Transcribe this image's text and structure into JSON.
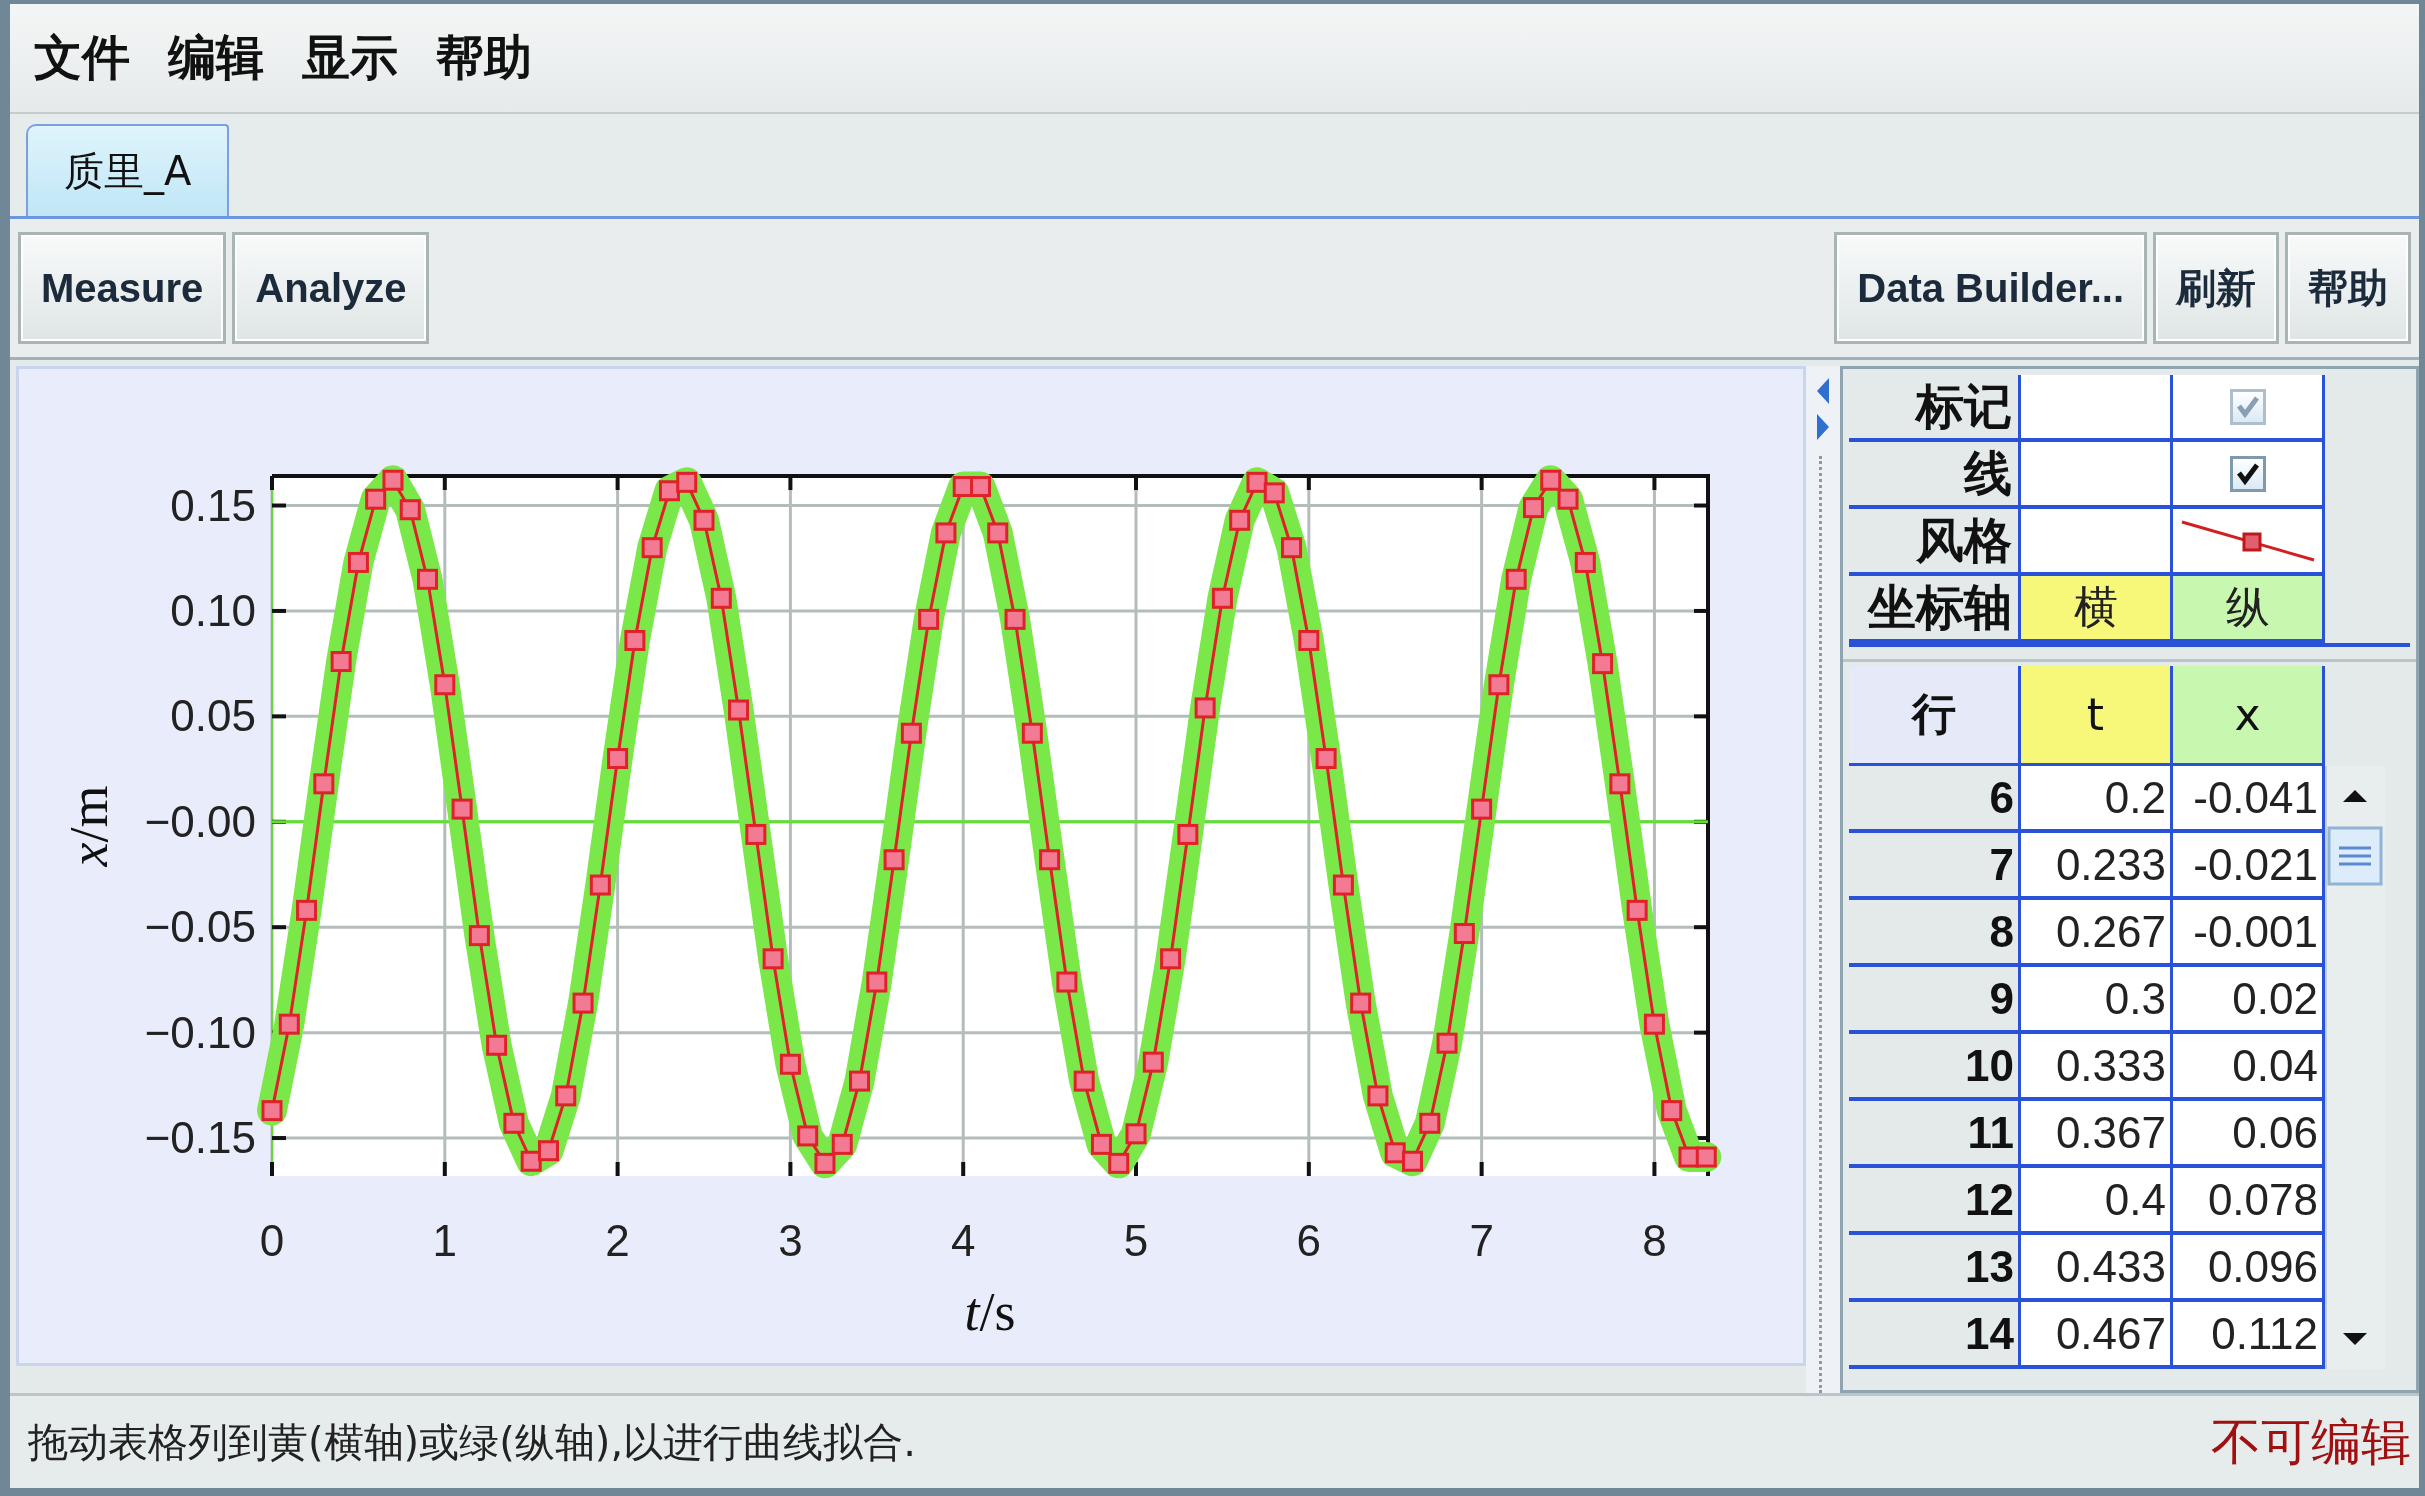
{
  "menu": [
    "文件",
    "编辑",
    "显示",
    "帮助"
  ],
  "tabs": [
    {
      "label": "质里_A",
      "selected": true
    }
  ],
  "toolbar": {
    "left": [
      "Measure",
      "Analyze"
    ],
    "right": [
      "Data Builder...",
      "刷新",
      "帮助"
    ]
  },
  "plot": {
    "chart_data": {
      "type": "line",
      "xlabel": "*t*/s",
      "ylabel": "*x*/m",
      "x": [
        0,
        0.1,
        0.2,
        0.3,
        0.4,
        0.5,
        0.6,
        0.7,
        0.8,
        0.9,
        1.0,
        1.1,
        1.2,
        1.3,
        1.4,
        1.5,
        1.6,
        1.7,
        1.8,
        1.9,
        2.0,
        2.1,
        2.2,
        2.3,
        2.4,
        2.5,
        2.6,
        2.7,
        2.8,
        2.9,
        3.0,
        3.1,
        3.2,
        3.3,
        3.4,
        3.5,
        3.6,
        3.7,
        3.8,
        3.9,
        4.0,
        4.1,
        4.2,
        4.3,
        4.4,
        4.5,
        4.6,
        4.7,
        4.8,
        4.9,
        5.0,
        5.1,
        5.2,
        5.3,
        5.4,
        5.5,
        5.6,
        5.7,
        5.8,
        5.9,
        6.0,
        6.1,
        6.2,
        6.3,
        6.4,
        6.5,
        6.6,
        6.7,
        6.8,
        6.9,
        7.0,
        7.1,
        7.2,
        7.3,
        7.4,
        7.5,
        7.6,
        7.7,
        7.8,
        7.9,
        8.0,
        8.1,
        8.2,
        8.3
      ],
      "grid": true,
      "ref_lines": [
        {
          "axis": "y",
          "value": 0,
          "color": "#5fe030"
        }
      ],
      "series": [
        {
          "color": "#e0202a",
          "marker": "square",
          "values": [
            -0.137,
            -0.096,
            -0.042,
            0.018,
            0.076,
            0.123,
            0.153,
            0.162,
            0.148,
            0.115,
            0.065,
            0.006,
            -0.054,
            -0.106,
            -0.143,
            -0.161,
            -0.156,
            -0.13,
            -0.086,
            -0.03,
            0.03,
            0.086,
            0.13,
            0.157,
            0.161,
            0.143,
            0.106,
            0.053,
            -0.006,
            -0.065,
            -0.115,
            -0.149,
            -0.162,
            -0.153,
            -0.123,
            -0.076,
            -0.018,
            0.042,
            0.096,
            0.137,
            0.159,
            0.159,
            0.137,
            0.096,
            0.042,
            -0.018,
            -0.076,
            -0.123,
            -0.153,
            -0.162,
            -0.148,
            -0.114,
            -0.065,
            -0.006,
            0.054,
            0.106,
            0.143,
            0.161,
            0.156,
            0.13,
            0.086,
            0.03,
            -0.03,
            -0.086,
            -0.13,
            -0.157,
            -0.161,
            -0.143,
            -0.105,
            -0.053,
            0.006,
            0.065,
            0.115,
            0.149,
            0.162,
            0.153,
            0.123,
            0.075,
            0.018,
            -0.042,
            -0.096,
            -0.137,
            -0.159,
            -0.159
          ]
        }
      ],
      "xlim": [
        0,
        8.31
      ],
      "ylim": [
        -0.168,
        0.164
      ],
      "xticks": [
        0,
        1,
        2,
        3,
        4,
        5,
        6,
        7,
        8
      ],
      "yticks": [
        {
          "value": 0.15,
          "label": "0.15"
        },
        {
          "value": 0.1,
          "label": "0.10"
        },
        {
          "value": 0.05,
          "label": "0.05"
        },
        {
          "value": 0,
          "label": "−0.00"
        },
        {
          "value": -0.05,
          "label": "−0.05"
        },
        {
          "value": -0.1,
          "label": "−0.10"
        },
        {
          "value": -0.15,
          "label": "−0.15"
        }
      ]
    }
  },
  "properties": {
    "rows": [
      {
        "kind": "checkbox",
        "label": "标记",
        "checked": true,
        "disabled": true
      },
      {
        "kind": "checkbox",
        "label": "线",
        "checked": true,
        "disabled": false
      },
      {
        "kind": "style",
        "label": "风格"
      },
      {
        "kind": "axis",
        "label": "坐标轴",
        "cells": [
          {
            "text": "横",
            "color": "#f7f77a"
          },
          {
            "text": "纵",
            "color": "#c8f7b0"
          }
        ]
      }
    ]
  },
  "table": {
    "columns": [
      {
        "label": "行"
      },
      {
        "label": "t",
        "color": "#f7f77a"
      },
      {
        "label": "x",
        "color": "#c8f7b0"
      }
    ],
    "rows": [
      [
        "6",
        "0.2",
        "-0.041"
      ],
      [
        "7",
        "0.233",
        "-0.021"
      ],
      [
        "8",
        "0.267",
        "-0.001"
      ],
      [
        "9",
        "0.3",
        "0.02"
      ],
      [
        "10",
        "0.333",
        "0.04"
      ],
      [
        "11",
        "0.367",
        "0.06"
      ],
      [
        "12",
        "0.4",
        "0.078"
      ],
      [
        "13",
        "0.433",
        "0.096"
      ],
      [
        "14",
        "0.467",
        "0.112"
      ]
    ]
  },
  "status_bar": {
    "hint": "拖动表格列到黄(横轴)或绿(纵轴),以进行曲线拟合.",
    "state": "不可编辑"
  }
}
